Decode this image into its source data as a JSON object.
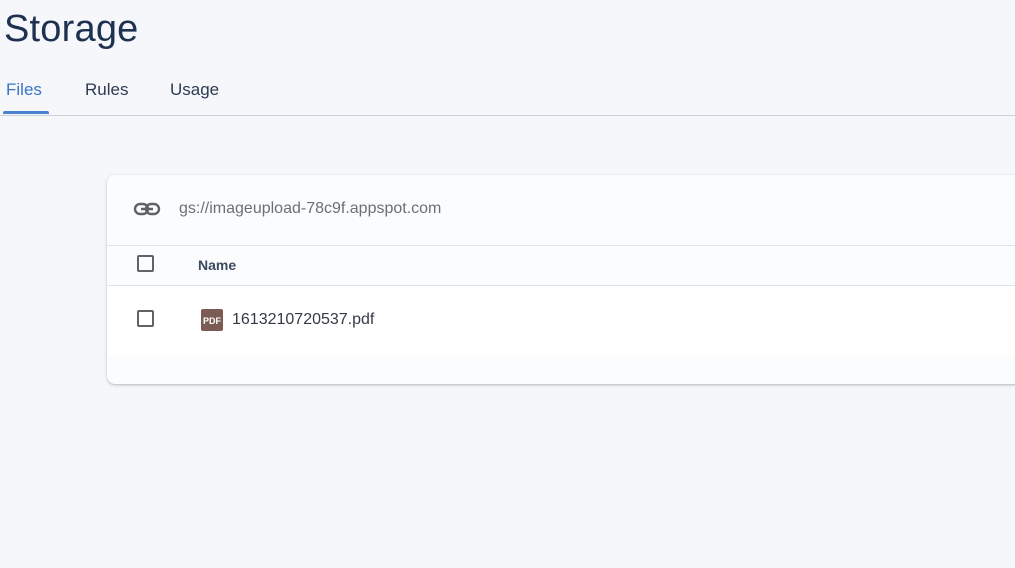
{
  "page": {
    "title": "Storage"
  },
  "tabs": [
    {
      "label": "Files",
      "active": true
    },
    {
      "label": "Rules",
      "active": false
    },
    {
      "label": "Usage",
      "active": false
    }
  ],
  "bucket": {
    "icon": "link-icon",
    "path": "gs://imageupload-78c9f.appspot.com"
  },
  "table": {
    "columns": [
      "Name"
    ],
    "rows": [
      {
        "icon": "pdf-icon",
        "icon_text": "PDF",
        "name": "1613210720537.pdf",
        "checked": false
      }
    ]
  },
  "colors": {
    "title": "#1f3150",
    "tab_active": "#3a74c9",
    "background": "#f5f7fa",
    "pdf_icon": "#7a5c55"
  }
}
